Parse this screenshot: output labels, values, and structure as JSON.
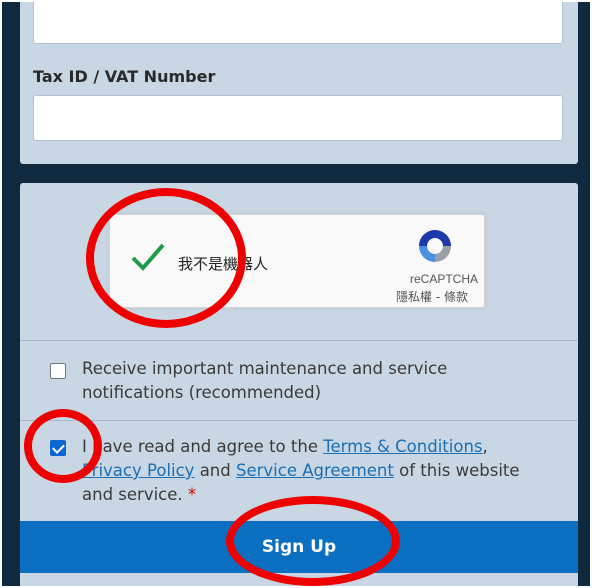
{
  "form": {
    "tax_label": "Tax ID / VAT Number",
    "tax_value": ""
  },
  "recaptcha": {
    "label": "我不是機器人",
    "brand": "reCAPTCHA",
    "privacy": "隱私權",
    "separator": " - ",
    "terms": "條款"
  },
  "options": {
    "notifications": {
      "checked": false,
      "text": "Receive important maintenance and service notifications (recommended)"
    },
    "agree": {
      "checked": true,
      "prefix": "I have read and agree to the ",
      "terms_link": "Terms & Conditions",
      "comma": ", ",
      "privacy_link": "Privacy Policy",
      "and": " and ",
      "service_link": "Service Agreement",
      "suffix": " of this website and service.",
      "required_mark": "*"
    }
  },
  "signup_label": "Sign Up",
  "colors": {
    "background": "#0f2a3e",
    "card": "#c9d6e3",
    "button": "#0a6fc0",
    "link": "#1a6fb5",
    "annotation": "#ee0000"
  }
}
